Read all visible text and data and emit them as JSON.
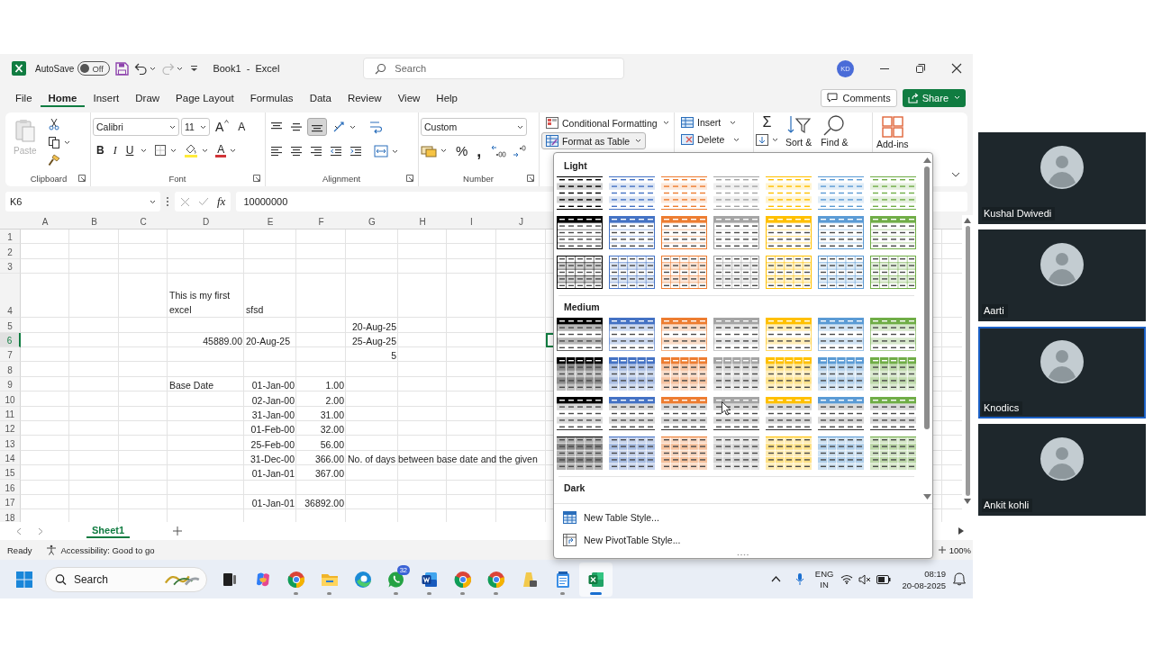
{
  "title_bar": {
    "autosave_label": "AutoSave",
    "autosave_on": false,
    "autosave_state": "Off",
    "document_title": "Book1  -  Excel",
    "search_placeholder": "Search",
    "account_initials": "KD"
  },
  "ribbon_tabs": [
    {
      "label": "File",
      "selected": false
    },
    {
      "label": "Home",
      "selected": true
    },
    {
      "label": "Insert",
      "selected": false
    },
    {
      "label": "Draw",
      "selected": false
    },
    {
      "label": "Page Layout",
      "selected": false
    },
    {
      "label": "Formulas",
      "selected": false
    },
    {
      "label": "Data",
      "selected": false
    },
    {
      "label": "Review",
      "selected": false
    },
    {
      "label": "View",
      "selected": false
    },
    {
      "label": "Help",
      "selected": false
    }
  ],
  "comments_button": "Comments",
  "share_button": "Share",
  "ribbon": {
    "clipboard": {
      "paste_label": "Paste",
      "paste_disabled": true,
      "group_label": "Clipboard"
    },
    "font": {
      "font_name": "Calibri",
      "font_size": "11",
      "grow_label": "A",
      "shrink_label": "A",
      "style_buttons": [
        "B",
        "I",
        "U"
      ],
      "font_color_label": "A",
      "group_label": "Font"
    },
    "alignment": {
      "vertical": [
        {
          "kind": "top",
          "selected": false
        },
        {
          "kind": "middle",
          "selected": false
        },
        {
          "kind": "bottom",
          "selected": true
        }
      ],
      "group_label": "Alignment"
    },
    "number": {
      "format": "Custom",
      "percent_label": "%",
      "comma_label": ",",
      "group_label": "Number"
    },
    "styles": {
      "conditional_formatting": "Conditional Formatting",
      "format_as_table": "Format as Table",
      "format_as_table_expanded": true
    },
    "cells": {
      "insert": "Insert",
      "delete": "Delete"
    },
    "editing": {
      "autosum_label": "Σ",
      "sort_label": "Sort &",
      "find_label": "Find &"
    },
    "add_ins": "Add-ins"
  },
  "formula_bar": {
    "name_box": "K6",
    "fx_label": "fx",
    "formula": "10000000"
  },
  "sheet": {
    "columns": [
      "A",
      "B",
      "C",
      "D",
      "E",
      "F",
      "G",
      "H",
      "I",
      "J"
    ],
    "rows": [
      {
        "number": "1",
        "tall": false,
        "selected": false
      },
      {
        "number": "2",
        "tall": false,
        "selected": false
      },
      {
        "number": "3",
        "tall": false,
        "selected": false
      },
      {
        "number": "4",
        "tall": true,
        "selected": false,
        "cells": [
          {
            "kind": "empty"
          },
          {
            "kind": "empty"
          },
          {
            "kind": "empty"
          },
          {
            "kind": "text",
            "text": "This is my first excel"
          },
          {
            "kind": "text",
            "text": "sfsd"
          }
        ]
      },
      {
        "number": "5",
        "tall": false,
        "selected": false,
        "cells": [
          {
            "kind": "empty"
          },
          {
            "kind": "empty"
          },
          {
            "kind": "empty"
          },
          {
            "kind": "empty"
          },
          {
            "kind": "empty"
          },
          {
            "kind": "empty"
          },
          {
            "kind": "number",
            "text": "20-Aug-25"
          }
        ]
      },
      {
        "number": "6",
        "tall": false,
        "selected": true,
        "cells": [
          {
            "kind": "empty"
          },
          {
            "kind": "empty"
          },
          {
            "kind": "empty"
          },
          {
            "kind": "number",
            "text": "45889.00"
          },
          {
            "kind": "text",
            "text": "20-Aug-25"
          },
          {
            "kind": "empty"
          },
          {
            "kind": "number",
            "text": "25-Aug-25"
          },
          {
            "kind": "empty"
          },
          {
            "kind": "empty"
          },
          {
            "kind": "empty"
          },
          {
            "kind": "selected"
          }
        ]
      },
      {
        "number": "7",
        "tall": false,
        "selected": false,
        "cells": [
          {
            "kind": "empty"
          },
          {
            "kind": "empty"
          },
          {
            "kind": "empty"
          },
          {
            "kind": "empty"
          },
          {
            "kind": "empty"
          },
          {
            "kind": "empty"
          },
          {
            "kind": "number",
            "text": "5"
          }
        ]
      },
      {
        "number": "8",
        "tall": false,
        "selected": false
      },
      {
        "number": "9",
        "tall": false,
        "selected": false,
        "cells": [
          {
            "kind": "empty"
          },
          {
            "kind": "empty"
          },
          {
            "kind": "empty"
          },
          {
            "kind": "text",
            "text": "Base Date"
          },
          {
            "kind": "number",
            "text": "01-Jan-00"
          },
          {
            "kind": "number",
            "text": "1.00"
          }
        ]
      },
      {
        "number": "10",
        "tall": false,
        "selected": false,
        "cells": [
          {
            "kind": "empty"
          },
          {
            "kind": "empty"
          },
          {
            "kind": "empty"
          },
          {
            "kind": "empty"
          },
          {
            "kind": "number",
            "text": "02-Jan-00"
          },
          {
            "kind": "number",
            "text": "2.00"
          }
        ]
      },
      {
        "number": "11",
        "tall": false,
        "selected": false,
        "cells": [
          {
            "kind": "empty"
          },
          {
            "kind": "empty"
          },
          {
            "kind": "empty"
          },
          {
            "kind": "empty"
          },
          {
            "kind": "number",
            "text": "31-Jan-00"
          },
          {
            "kind": "number",
            "text": "31.00"
          }
        ]
      },
      {
        "number": "12",
        "tall": false,
        "selected": false,
        "cells": [
          {
            "kind": "empty"
          },
          {
            "kind": "empty"
          },
          {
            "kind": "empty"
          },
          {
            "kind": "empty"
          },
          {
            "kind": "number",
            "text": "01-Feb-00"
          },
          {
            "kind": "number",
            "text": "32.00"
          }
        ]
      },
      {
        "number": "13",
        "tall": false,
        "selected": false,
        "cells": [
          {
            "kind": "empty"
          },
          {
            "kind": "empty"
          },
          {
            "kind": "empty"
          },
          {
            "kind": "empty"
          },
          {
            "kind": "number",
            "text": "25-Feb-00"
          },
          {
            "kind": "number",
            "text": "56.00"
          }
        ]
      },
      {
        "number": "14",
        "tall": false,
        "selected": false,
        "cells": [
          {
            "kind": "empty"
          },
          {
            "kind": "empty"
          },
          {
            "kind": "empty"
          },
          {
            "kind": "empty"
          },
          {
            "kind": "number",
            "text": "31-Dec-00"
          },
          {
            "kind": "number",
            "text": "366.00"
          },
          {
            "kind": "text",
            "text": "No. of days between base date and the given"
          }
        ]
      },
      {
        "number": "15",
        "tall": false,
        "selected": false,
        "cells": [
          {
            "kind": "empty"
          },
          {
            "kind": "empty"
          },
          {
            "kind": "empty"
          },
          {
            "kind": "empty"
          },
          {
            "kind": "number",
            "text": "01-Jan-01"
          },
          {
            "kind": "number",
            "text": "367.00"
          }
        ]
      },
      {
        "number": "16",
        "tall": false,
        "selected": false
      },
      {
        "number": "17",
        "tall": false,
        "selected": false,
        "cells": [
          {
            "kind": "empty"
          },
          {
            "kind": "empty"
          },
          {
            "kind": "empty"
          },
          {
            "kind": "empty"
          },
          {
            "kind": "number",
            "text": "01-Jan-01"
          },
          {
            "kind": "number",
            "text": "36892.00"
          }
        ]
      },
      {
        "number": "18",
        "tall": false,
        "selected": false
      }
    ]
  },
  "sheet_tabs": [
    {
      "label": "Sheet1",
      "selected": true
    }
  ],
  "status_bar": {
    "mode": "Ready",
    "accessibility": "Accessibility: Good to go",
    "zoom": "100%"
  },
  "table_style_gallery": {
    "swatches": [
      {
        "color": "#000000"
      },
      {
        "color": "#4472c4"
      },
      {
        "color": "#ed7d31"
      },
      {
        "color": "#a5a5a5"
      },
      {
        "color": "#ffc000"
      },
      {
        "color": "#5b9bd5"
      },
      {
        "color": "#70ad47"
      }
    ],
    "sections": [
      {
        "title": "Light",
        "rows": [
          {
            "kind": "light-banded"
          },
          {
            "kind": "light-header"
          },
          {
            "kind": "light-grid"
          }
        ]
      },
      {
        "title": "Medium",
        "rows": [
          {
            "kind": "medium-banded"
          },
          {
            "kind": "medium-grid"
          },
          {
            "kind": "medium-header-grey"
          },
          {
            "kind": "medium-tinted"
          }
        ]
      },
      {
        "title": "Dark"
      }
    ],
    "actions": [
      {
        "kind": "new-table-style",
        "label": "New Table Style..."
      },
      {
        "kind": "new-pivot-style",
        "label": "New PivotTable Style..."
      }
    ]
  },
  "taskbar": {
    "search_placeholder": "Search",
    "apps": [
      {
        "kind": "task-view",
        "running": false,
        "active": false
      },
      {
        "kind": "copilot",
        "running": false,
        "active": false
      },
      {
        "kind": "chrome",
        "running": true,
        "active": false
      },
      {
        "kind": "files",
        "running": true,
        "active": false
      },
      {
        "kind": "edge",
        "running": false,
        "active": false
      },
      {
        "kind": "whatsapp",
        "running": true,
        "active": false,
        "badge": "32"
      },
      {
        "kind": "word",
        "running": true,
        "active": false
      },
      {
        "kind": "chrome",
        "running": true,
        "active": false
      },
      {
        "kind": "chrome",
        "running": true,
        "active": false
      },
      {
        "kind": "app",
        "running": false,
        "active": false
      },
      {
        "kind": "notepad",
        "running": true,
        "active": false
      },
      {
        "kind": "excel",
        "running": true,
        "active": true
      }
    ],
    "language": "ENG",
    "region": "IN",
    "time": "08:19",
    "date": "20-08-2025"
  },
  "participants": [
    {
      "name": "Kushal Dwivedi",
      "highlighted": false
    },
    {
      "name": "Aarti",
      "highlighted": false
    },
    {
      "name": "Knodics",
      "highlighted": true
    },
    {
      "name": "Ankit kohli",
      "highlighted": false
    }
  ]
}
